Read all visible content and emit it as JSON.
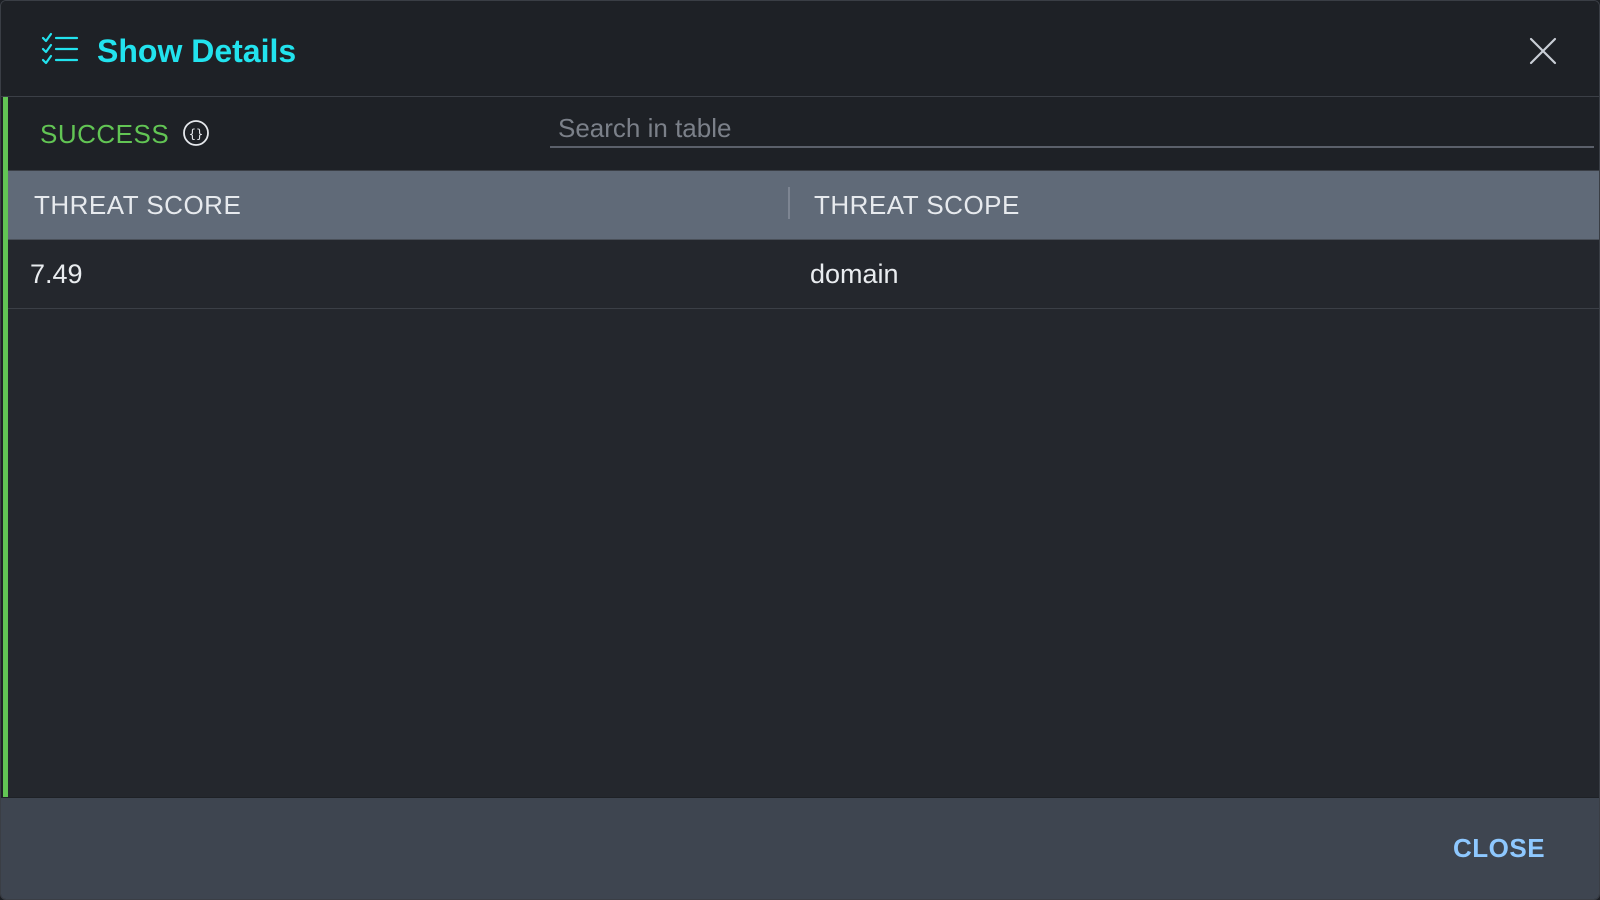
{
  "dialog": {
    "title": "Show Details",
    "title_icon": "checklist-icon",
    "close_icon": "close-icon"
  },
  "toolbar": {
    "status": "SUCCESS",
    "json_icon": "json-braces-icon",
    "search_placeholder": "Search in table",
    "search_value": ""
  },
  "table": {
    "columns": [
      "THREAT SCORE",
      "THREAT SCOPE"
    ],
    "rows": [
      [
        "7.49",
        "domain"
      ]
    ]
  },
  "footer": {
    "close_label": "CLOSE"
  },
  "colors": {
    "accent": "#22e3ee",
    "success": "#62c554",
    "link": "#8ec8ff"
  }
}
